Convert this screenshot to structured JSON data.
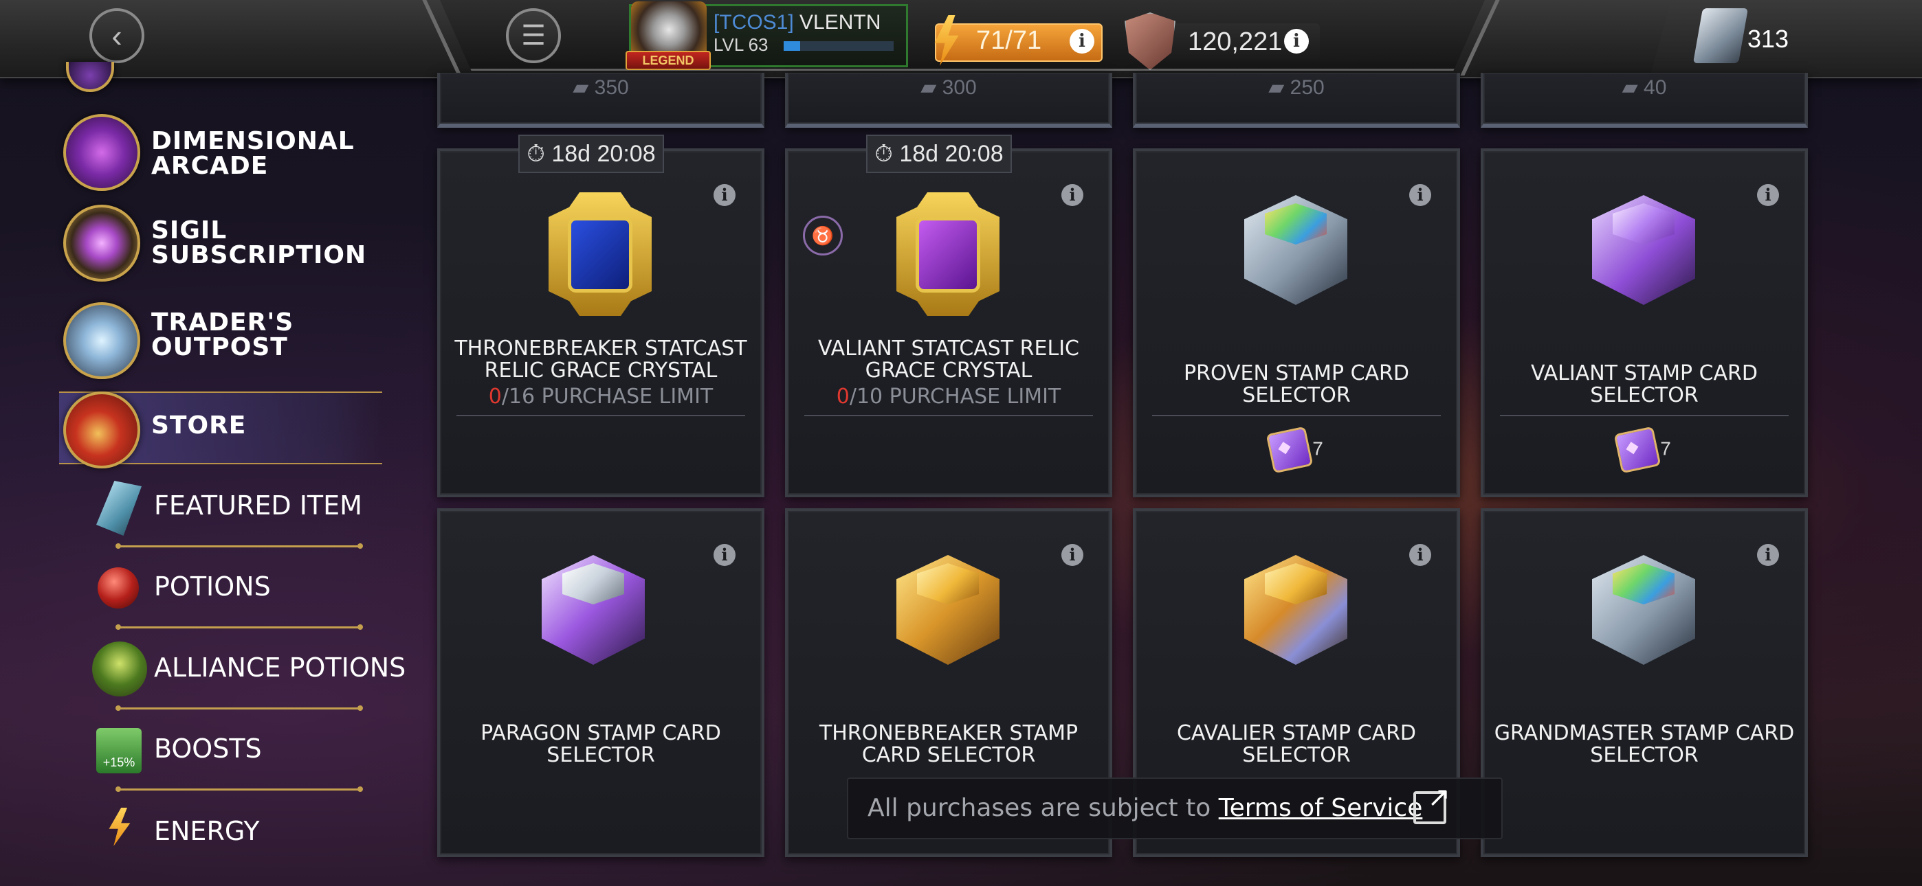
{
  "header": {
    "back_icon": "back-arrow-icon",
    "menu_icon": "hamburger-menu-icon",
    "alliance_tag": "[TCOS1]",
    "player_name": "VLENTN",
    "level_label": "LVL 63",
    "level_progress": 0.15,
    "legend_tag": "LEGEND",
    "energy": "71/71",
    "rating": "120,221",
    "units": "313"
  },
  "sidebar": {
    "items": [
      {
        "label_line1": "DIMENSIONAL",
        "label_line2": "ARCADE"
      },
      {
        "label_line1": "SIGIL",
        "label_line2": "SUBSCRIPTION"
      },
      {
        "label_line1": "TRADER'S",
        "label_line2": "OUTPOST"
      },
      {
        "label_line1": "STORE",
        "label_line2": ""
      }
    ],
    "sub_items": [
      {
        "label": "FEATURED ITEM"
      },
      {
        "label": "POTIONS"
      },
      {
        "label": "ALLIANCE POTIONS"
      },
      {
        "label": "BOOSTS",
        "badge": "+15%"
      },
      {
        "label": "ENERGY"
      }
    ]
  },
  "top_row_prices": [
    "350",
    "300",
    "250",
    "40"
  ],
  "cards": [
    {
      "timer": "18d 20:08",
      "title_line1": "THRONEBREAKER STATCAST",
      "title_line2": "RELIC GRACE CRYSTAL",
      "limit_zero": "0",
      "limit_rest": "/16 PURCHASE LIMIT"
    },
    {
      "timer": "18d 20:08",
      "title_line1": "VALIANT STATCAST RELIC",
      "title_line2": "GRACE CRYSTAL",
      "limit_zero": "0",
      "limit_rest": "/10 PURCHASE LIMIT"
    },
    {
      "title_line1": "PROVEN STAMP CARD",
      "title_line2": "SELECTOR",
      "price": "7"
    },
    {
      "title_line1": "VALIANT STAMP CARD",
      "title_line2": "SELECTOR",
      "price": "7"
    },
    {
      "title_line1": "PARAGON STAMP CARD",
      "title_line2": "SELECTOR"
    },
    {
      "title_line1": "THRONEBREAKER STAMP",
      "title_line2": "CARD SELECTOR"
    },
    {
      "title_line1": "CAVALIER STAMP CARD",
      "title_line2": "SELECTOR"
    },
    {
      "title_line1": "GRANDMASTER STAMP CARD",
      "title_line2": "SELECTOR"
    }
  ],
  "footer": {
    "text": "All purchases are subject to ",
    "link": "Terms of Service"
  },
  "colors": {
    "energy": "#e98a22",
    "accent_gold": "#c4a04e",
    "limit_zero": "#e0382f",
    "player_tag": "#4e8bd6"
  }
}
